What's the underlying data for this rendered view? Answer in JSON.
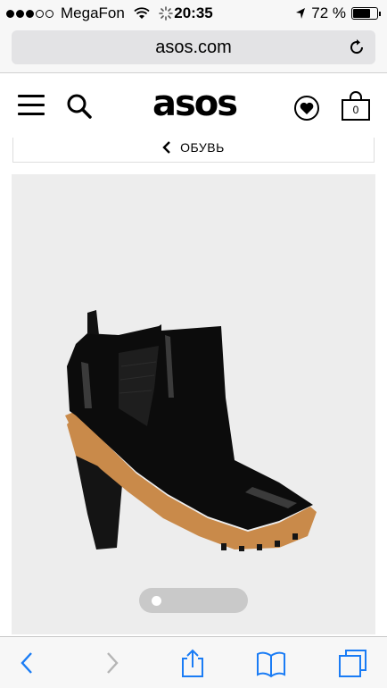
{
  "status": {
    "carrier": "MegaFon",
    "time": "20:35",
    "battery": "72 %",
    "battery_level": 0.72
  },
  "browser": {
    "url": "asos.com"
  },
  "header": {
    "logo": "asos",
    "bag_count": "0"
  },
  "breadcrumb": {
    "label": "ОБУВЬ"
  },
  "gallery": {
    "current_image": 1
  },
  "icons": {
    "menu": "hamburger-icon",
    "search": "search-icon",
    "saved": "heart-icon",
    "bag": "bag-icon",
    "reload": "reload-icon",
    "back": "chevron-left-icon",
    "forward": "chevron-right-icon",
    "share": "share-icon",
    "bookmarks": "book-icon",
    "tabs": "tabs-icon"
  },
  "colors": {
    "toolbar_blue": "#1a7cf5",
    "forward_disabled": "#b5b5b5",
    "image_bg": "#ededed",
    "sole": "#c98a4a"
  }
}
